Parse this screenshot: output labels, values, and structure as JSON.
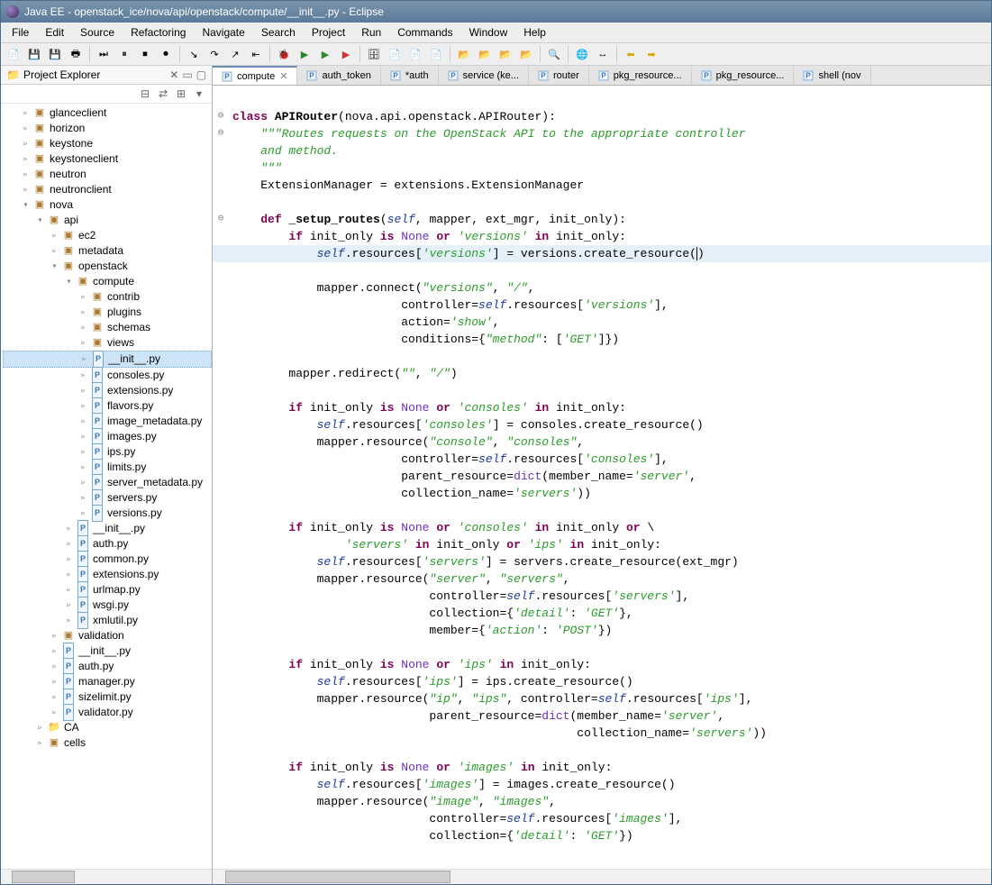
{
  "title": "Java EE - openstack_ice/nova/api/openstack/compute/__init__.py - Eclipse",
  "menu": [
    "File",
    "Edit",
    "Source",
    "Refactoring",
    "Navigate",
    "Search",
    "Project",
    "Run",
    "Commands",
    "Window",
    "Help"
  ],
  "explorer": {
    "title": "Project Explorer",
    "tree": [
      {
        "lvl": 1,
        "tw": "▹",
        "ic": "pkg",
        "label": "glanceclient"
      },
      {
        "lvl": 1,
        "tw": "▹",
        "ic": "pkg",
        "label": "horizon"
      },
      {
        "lvl": 1,
        "tw": "▹",
        "ic": "pkg",
        "label": "keystone"
      },
      {
        "lvl": 1,
        "tw": "▹",
        "ic": "pkg",
        "label": "keystoneclient"
      },
      {
        "lvl": 1,
        "tw": "▹",
        "ic": "pkg",
        "label": "neutron"
      },
      {
        "lvl": 1,
        "tw": "▹",
        "ic": "pkg",
        "label": "neutronclient"
      },
      {
        "lvl": 1,
        "tw": "▾",
        "ic": "pkg",
        "label": "nova"
      },
      {
        "lvl": 2,
        "tw": "▾",
        "ic": "pkg",
        "label": "api"
      },
      {
        "lvl": 3,
        "tw": "▹",
        "ic": "pkg",
        "label": "ec2"
      },
      {
        "lvl": 3,
        "tw": "▹",
        "ic": "pkg",
        "label": "metadata"
      },
      {
        "lvl": 3,
        "tw": "▾",
        "ic": "pkg",
        "label": "openstack"
      },
      {
        "lvl": 4,
        "tw": "▾",
        "ic": "pkg",
        "label": "compute"
      },
      {
        "lvl": 5,
        "tw": "▹",
        "ic": "pkg",
        "label": "contrib"
      },
      {
        "lvl": 5,
        "tw": "▹",
        "ic": "pkg",
        "label": "plugins"
      },
      {
        "lvl": 5,
        "tw": "▹",
        "ic": "pkg",
        "label": "schemas"
      },
      {
        "lvl": 5,
        "tw": "▹",
        "ic": "pkg",
        "label": "views"
      },
      {
        "lvl": 5,
        "tw": "▹",
        "ic": "py",
        "label": "__init__.py",
        "sel": true
      },
      {
        "lvl": 5,
        "tw": "▹",
        "ic": "py",
        "label": "consoles.py"
      },
      {
        "lvl": 5,
        "tw": "▹",
        "ic": "py",
        "label": "extensions.py"
      },
      {
        "lvl": 5,
        "tw": "▹",
        "ic": "py",
        "label": "flavors.py"
      },
      {
        "lvl": 5,
        "tw": "▹",
        "ic": "py",
        "label": "image_metadata.py"
      },
      {
        "lvl": 5,
        "tw": "▹",
        "ic": "py",
        "label": "images.py"
      },
      {
        "lvl": 5,
        "tw": "▹",
        "ic": "py",
        "label": "ips.py"
      },
      {
        "lvl": 5,
        "tw": "▹",
        "ic": "py",
        "label": "limits.py"
      },
      {
        "lvl": 5,
        "tw": "▹",
        "ic": "py",
        "label": "server_metadata.py"
      },
      {
        "lvl": 5,
        "tw": "▹",
        "ic": "py",
        "label": "servers.py"
      },
      {
        "lvl": 5,
        "tw": "▹",
        "ic": "py",
        "label": "versions.py"
      },
      {
        "lvl": 4,
        "tw": "▹",
        "ic": "py",
        "label": "__init__.py"
      },
      {
        "lvl": 4,
        "tw": "▹",
        "ic": "py",
        "label": "auth.py"
      },
      {
        "lvl": 4,
        "tw": "▹",
        "ic": "py",
        "label": "common.py"
      },
      {
        "lvl": 4,
        "tw": "▹",
        "ic": "py",
        "label": "extensions.py"
      },
      {
        "lvl": 4,
        "tw": "▹",
        "ic": "py",
        "label": "urlmap.py"
      },
      {
        "lvl": 4,
        "tw": "▹",
        "ic": "py",
        "label": "wsgi.py"
      },
      {
        "lvl": 4,
        "tw": "▹",
        "ic": "py",
        "label": "xmlutil.py"
      },
      {
        "lvl": 3,
        "tw": "▹",
        "ic": "pkg",
        "label": "validation"
      },
      {
        "lvl": 3,
        "tw": "▹",
        "ic": "py",
        "label": "__init__.py"
      },
      {
        "lvl": 3,
        "tw": "▹",
        "ic": "py",
        "label": "auth.py"
      },
      {
        "lvl": 3,
        "tw": "▹",
        "ic": "py",
        "label": "manager.py"
      },
      {
        "lvl": 3,
        "tw": "▹",
        "ic": "py",
        "label": "sizelimit.py"
      },
      {
        "lvl": 3,
        "tw": "▹",
        "ic": "py",
        "label": "validator.py"
      },
      {
        "lvl": 2,
        "tw": "▹",
        "ic": "fld",
        "label": "CA"
      },
      {
        "lvl": 2,
        "tw": "▹",
        "ic": "pkg",
        "label": "cells"
      }
    ]
  },
  "tabs": [
    {
      "label": "compute",
      "active": true,
      "close": true
    },
    {
      "label": "auth_token"
    },
    {
      "label": "*auth"
    },
    {
      "label": "service (ke..."
    },
    {
      "label": "router"
    },
    {
      "label": "pkg_resource..."
    },
    {
      "label": "pkg_resource..."
    },
    {
      "label": "shell (nov"
    }
  ]
}
